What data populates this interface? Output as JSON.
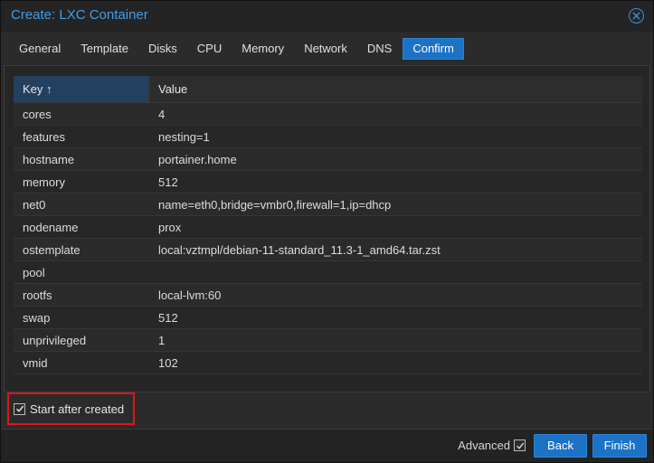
{
  "dialog": {
    "title": "Create: LXC Container",
    "tabs": [
      {
        "label": "General"
      },
      {
        "label": "Template"
      },
      {
        "label": "Disks"
      },
      {
        "label": "CPU"
      },
      {
        "label": "Memory"
      },
      {
        "label": "Network"
      },
      {
        "label": "DNS"
      },
      {
        "label": "Confirm",
        "active": true
      }
    ]
  },
  "grid": {
    "columns": {
      "key": "Key ↑",
      "value": "Value"
    },
    "rows": [
      {
        "key": "cores",
        "value": "4"
      },
      {
        "key": "features",
        "value": "nesting=1"
      },
      {
        "key": "hostname",
        "value": "portainer.home"
      },
      {
        "key": "memory",
        "value": "512"
      },
      {
        "key": "net0",
        "value": "name=eth0,bridge=vmbr0,firewall=1,ip=dhcp"
      },
      {
        "key": "nodename",
        "value": "prox"
      },
      {
        "key": "ostemplate",
        "value": "local:vztmpl/debian-11-standard_11.3-1_amd64.tar.zst"
      },
      {
        "key": "pool",
        "value": ""
      },
      {
        "key": "rootfs",
        "value": "local-lvm:60"
      },
      {
        "key": "swap",
        "value": "512"
      },
      {
        "key": "unprivileged",
        "value": "1"
      },
      {
        "key": "vmid",
        "value": "102"
      }
    ]
  },
  "options": {
    "start_after_created": {
      "label": "Start after created",
      "checked": true
    },
    "advanced": {
      "label": "Advanced",
      "checked": true
    }
  },
  "buttons": {
    "back": "Back",
    "finish": "Finish"
  },
  "colors": {
    "accent": "#1c72c4",
    "title": "#3f9ee8",
    "highlight": "#e0141a"
  }
}
